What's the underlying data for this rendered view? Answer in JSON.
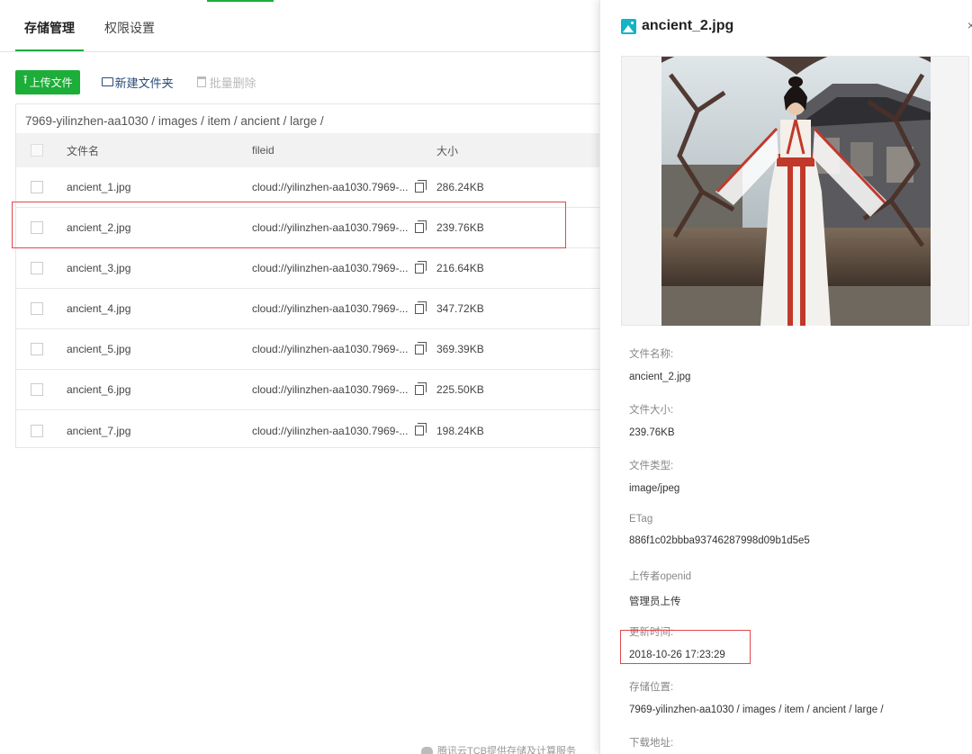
{
  "tabs": [
    {
      "label": "存储管理",
      "active": true
    },
    {
      "label": "权限设置",
      "active": false
    }
  ],
  "toolbar": {
    "upload_label": "上传文件",
    "new_folder_label": "新建文件夹",
    "batch_delete_label": "批量删除"
  },
  "breadcrumb": "7969-yilinzhen-aa1030 / images / item / ancient / large /",
  "columns": {
    "name": "文件名",
    "fileid": "fileid",
    "size": "大小"
  },
  "files": [
    {
      "name": "ancient_1.jpg",
      "fileid": "cloud://yilinzhen-aa1030.7969-...",
      "size": "286.24KB"
    },
    {
      "name": "ancient_2.jpg",
      "fileid": "cloud://yilinzhen-aa1030.7969-...",
      "size": "239.76KB"
    },
    {
      "name": "ancient_3.jpg",
      "fileid": "cloud://yilinzhen-aa1030.7969-...",
      "size": "216.64KB"
    },
    {
      "name": "ancient_4.jpg",
      "fileid": "cloud://yilinzhen-aa1030.7969-...",
      "size": "347.72KB"
    },
    {
      "name": "ancient_5.jpg",
      "fileid": "cloud://yilinzhen-aa1030.7969-...",
      "size": "369.39KB"
    },
    {
      "name": "ancient_6.jpg",
      "fileid": "cloud://yilinzhen-aa1030.7969-...",
      "size": "225.50KB"
    },
    {
      "name": "ancient_7.jpg",
      "fileid": "cloud://yilinzhen-aa1030.7969-...",
      "size": "198.24KB"
    }
  ],
  "footer": "腾讯云TCB提供存储及计算服务",
  "panel": {
    "title": "ancient_2.jpg",
    "fields": [
      {
        "label": "文件名称:",
        "value": "ancient_2.jpg"
      },
      {
        "label": "文件大小:",
        "value": "239.76KB"
      },
      {
        "label": "文件类型:",
        "value": "image/jpeg"
      },
      {
        "label": "ETag",
        "value": "886f1c02bbba93746287998d09b1d5e5"
      },
      {
        "label": "上传者openid",
        "value": "管理员上传"
      },
      {
        "label": "更新时间:",
        "value": "2018-10-26 17:23:29"
      },
      {
        "label": "存储位置:",
        "value": "7969-yilinzhen-aa1030 / images / item / ancient / large /"
      },
      {
        "label": "下载地址:",
        "value": ""
      }
    ]
  },
  "colors": {
    "accent": "#1dad39",
    "highlight": "#e0484d",
    "icon": "#12b4c5"
  }
}
